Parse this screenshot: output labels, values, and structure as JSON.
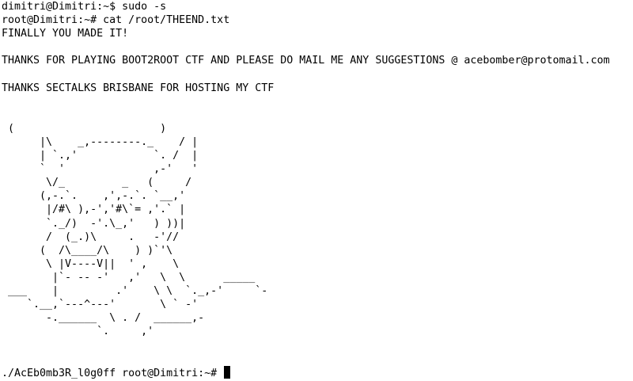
{
  "terminal": {
    "lines": [
      "dimitri@Dimitri:~$ sudo -s",
      "root@Dimitri:~# cat /root/THEEND.txt",
      "FINALLY YOU MADE IT!",
      "",
      "THANKS FOR PLAYING BOOT2ROOT CTF AND PLEASE DO MAIL ME ANY SUGGESTIONS @ acebomber@protomail.com",
      "",
      "THANKS SECTALKS BRISBANE FOR HOSTING MY CTF",
      "",
      "",
      " (                       )",
      "      |\\    _,--------._    / |",
      "      | `.,'            `. /  |",
      "      `  '              ,-'   '",
      "       \\/_         _   (     /",
      "      (,-.`.    ,',-.`. `__,'",
      "       |/#\\ ),-','#\\`= ,'.` |",
      "       `._/)  -'.\\_,'   ) ))|",
      "       /  (_.)\\     .   -'//",
      "      (  /\\____/\\    ) )`'\\",
      "       \\ |V----V||  ' ,    \\",
      "        |`- -- -'   ,'   \\  \\      _____",
      " ___    |         .'    \\ \\  `._,-'     `-",
      "    `.__,`---^---'       \\ ` -'",
      "       -.______  \\ . /  ______,-",
      "               `.     ,'",
      "",
      "",
      "./AcEb0mb3R_l0g0ff root@Dimitri:~# "
    ]
  },
  "colors": {
    "background": "#ffffff",
    "foreground": "#000000",
    "cursor": "#000000"
  }
}
